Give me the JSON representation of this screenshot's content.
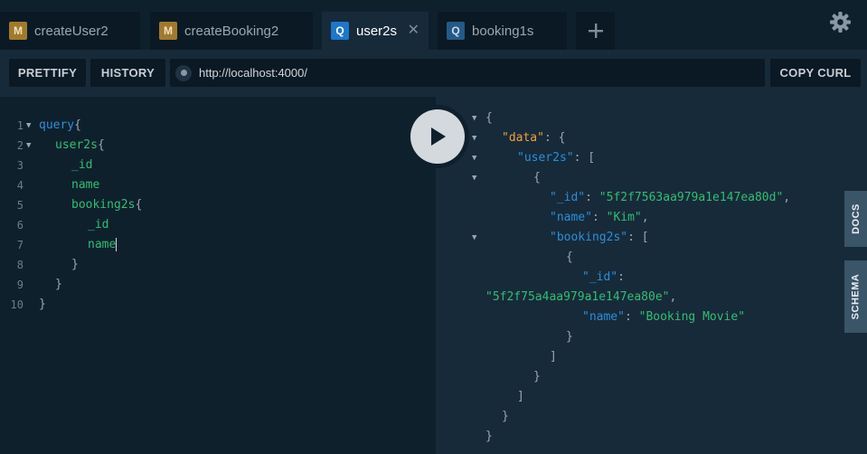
{
  "tabs": [
    {
      "badge": "M",
      "label": "createUser2",
      "active": false
    },
    {
      "badge": "M",
      "label": "createBooking2",
      "active": false
    },
    {
      "badge": "Q",
      "label": "user2s",
      "active": true,
      "close": "✕"
    },
    {
      "badge": "Q",
      "label": "booking1s",
      "active": false
    }
  ],
  "toolbar": {
    "prettify_label": "PRETTIFY",
    "history_label": "HISTORY",
    "url": "http://localhost:4000/",
    "copy_curl_label": "COPY CURL"
  },
  "query_editor": {
    "line_numbers": [
      "1",
      "2",
      "3",
      "4",
      "5",
      "6",
      "7",
      "8",
      "9",
      "10"
    ],
    "tokens": {
      "l1_kw": "query",
      "l1_p": "{",
      "l2_f": "user2s",
      "l2_p": "{",
      "l3_f": "_id",
      "l4_f": "name",
      "l5_f": "booking2s",
      "l5_p": "{",
      "l6_f": "_id",
      "l7_f": "name",
      "l8_p": "}",
      "l9_p": "}",
      "l10_p": "}"
    }
  },
  "result": {
    "open_brace": "{",
    "data_key": "\"data\"",
    "colon_brace": ": {",
    "users_key": "\"user2s\"",
    "colon_bracket": ": [",
    "obj_open": "{",
    "id_key": "\"_id\"",
    "id_value": "\"5f2f7563aa979a1e147ea80d\"",
    "name_key": "\"name\"",
    "name_value": "\"Kim\"",
    "bookings_key": "\"booking2s\"",
    "booking_obj_open": "{",
    "booking_id_key": "\"_id\"",
    "booking_id_value": "\"5f2f75a4aa979a1e147ea80e\"",
    "booking_name_key": "\"name\"",
    "booking_name_value": "\"Booking Movie\"",
    "close_obj": "}",
    "close_arr": "]",
    "close_user": "}",
    "close_users": "]",
    "close_data": "}",
    "close_root": "}"
  },
  "side_tabs": {
    "docs_label": "DOCS",
    "schema_label": "SCHEMA"
  },
  "icons": {
    "add_tab": "plus-icon",
    "settings": "gear-icon",
    "run": "play-icon"
  },
  "colors": {
    "mutation_badge": "#a07a2c",
    "query_badge": "#1e76c9",
    "keyword": "#2b8fd8",
    "field": "#2fbf71",
    "result_top_key": "#f2a03b"
  }
}
